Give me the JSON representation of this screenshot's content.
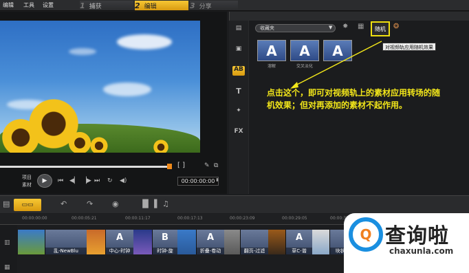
{
  "menu": {
    "edit": "编辑",
    "tools": "工具",
    "settings": "设置"
  },
  "steps": [
    {
      "num": "1",
      "label": "捕获"
    },
    {
      "num": "2",
      "label": "编辑"
    },
    {
      "num": "3",
      "label": "分享"
    }
  ],
  "preview": {
    "labels": {
      "project": "项目",
      "clip": "素材"
    },
    "timecode": "00:00:00:00",
    "bracket": "[  ]",
    "scrub_progress": 0.85
  },
  "library": {
    "dropdown": "收藏夹",
    "tooltip": "对视频轨应用随机效果",
    "random_icon_text": "随机",
    "thumbs": [
      {
        "glyph": "A",
        "label": "溶解"
      },
      {
        "glyph": "A",
        "label": "交叉淡化"
      },
      {
        "glyph": "A",
        "label": ""
      }
    ],
    "side_tr": "AB",
    "side_fx": "FX",
    "side_t": "T"
  },
  "annotation": "点击这个，即可对视频轨上的素材应用转场的随机效果；但对再添加的素材不起作用。",
  "timeline": {
    "ticks": [
      "00:00:00:00",
      "00:00:05:21",
      "00:00:11:17",
      "00:00:17:13",
      "00:00:23:09",
      "00:00:29:05",
      "00:00:35"
    ],
    "transitions": [
      {
        "glyph": "",
        "label": "乱-NewBlu"
      },
      {
        "glyph": "A",
        "label": "中心-时钟"
      },
      {
        "glyph": "B",
        "label": "时钟-旋"
      },
      {
        "glyph": "A",
        "label": "折叠-卷动"
      },
      {
        "glyph": "",
        "label": "翻页-过滤"
      },
      {
        "glyph": "A",
        "label": "草C-谐"
      },
      {
        "glyph": "",
        "label": "块状效"
      }
    ]
  },
  "watermark": {
    "logo": "Q",
    "text": "查询啦",
    "url": "chaxunla.com"
  }
}
